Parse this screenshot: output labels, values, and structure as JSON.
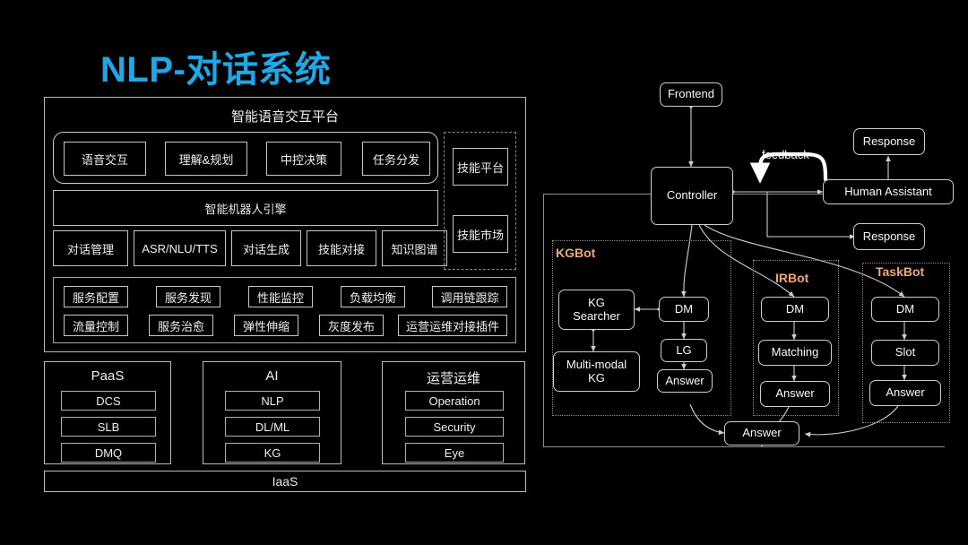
{
  "page": {
    "title": "NLP-对话系统",
    "accent_color": "#1fa8e8",
    "bot_label_color": "#f0a878",
    "background_color": "#000000"
  },
  "architecture": {
    "platform_title": "智能语音交互平台",
    "top_capabilities": [
      "语音交互",
      "理解&规划",
      "中控决策",
      "任务分发"
    ],
    "engine_bar": "智能机器人引擎",
    "engine_modules": [
      "对话管理",
      "ASR/NLU/TTS",
      "对话生成",
      "技能对接",
      "知识图谱"
    ],
    "skill_panel": [
      "技能平台",
      "技能市场"
    ],
    "ops_row1": [
      "服务配置",
      "服务发现",
      "性能监控",
      "负载均衡",
      "调用链跟踪"
    ],
    "ops_row2": [
      "流量控制",
      "服务治愈",
      "弹性伸缩",
      "灰度发布",
      "运营运维对接插件"
    ],
    "stacks": [
      {
        "title": "PaaS",
        "items": [
          "DCS",
          "SLB",
          "DMQ"
        ]
      },
      {
        "title": "AI",
        "items": [
          "NLP",
          "DL/ML",
          "KG"
        ]
      },
      {
        "title": "运营运维",
        "items": [
          "Operation",
          "Security",
          "Eye"
        ]
      }
    ],
    "foundation": "IaaS"
  },
  "flow": {
    "frontend": "Frontend",
    "controller": "Controller",
    "feedback": "feedback",
    "human_assistant": "Human Assistant",
    "response_top": "Response",
    "response_bottom": "Response",
    "final_answer": "Answer",
    "bots": [
      {
        "name": "KGBot",
        "nodes": {
          "kg_searcher": "KG\nSearcher",
          "kg_searcher_line1": "KG",
          "kg_searcher_line2": "Searcher",
          "multimodal_line1": "Multi-modal",
          "multimodal_line2": "KG",
          "dm": "DM",
          "lg": "LG",
          "answer": "Answer"
        }
      },
      {
        "name": "IRBot",
        "nodes": {
          "dm": "DM",
          "matching": "Matching",
          "answer": "Answer"
        }
      },
      {
        "name": "TaskBot",
        "nodes": {
          "dm": "DM",
          "slot": "Slot",
          "answer": "Answer"
        }
      }
    ]
  }
}
